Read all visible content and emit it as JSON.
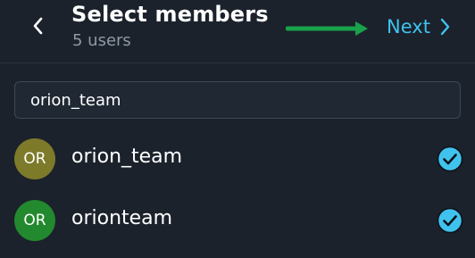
{
  "header": {
    "title": "Select members",
    "subtitle": "5 users",
    "back_icon": "chevron-left-icon",
    "next_label": "Next",
    "next_icon": "chevron-right-icon",
    "annotation_arrow_color": "#1aa24b",
    "accent_color": "#3fc3ee"
  },
  "search": {
    "value": "orion_team",
    "placeholder": ""
  },
  "members": [
    {
      "initials": "OR",
      "name": "orion_team",
      "avatar_color": "#7d7a2a",
      "selected": true,
      "check_icon": "check-circle-icon"
    },
    {
      "initials": "OR",
      "name": "orionteam",
      "avatar_color": "#23892e",
      "selected": true,
      "check_icon": "check-circle-icon"
    }
  ]
}
